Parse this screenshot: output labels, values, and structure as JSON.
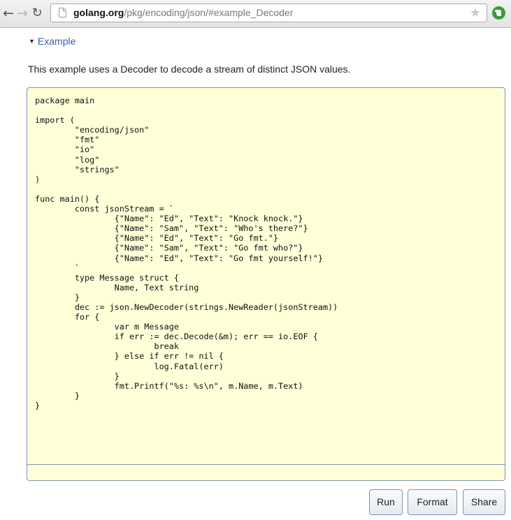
{
  "browser": {
    "back_glyph": "←",
    "forward_glyph": "→",
    "reload_glyph": "↻",
    "url_host": "golang.org",
    "url_path": "/pkg/encoding/json/#example_Decoder",
    "star_glyph": "★",
    "extension_icon": "evernote-icon",
    "extension_color": "#3c9b3c"
  },
  "example": {
    "toggle_caret": "▼",
    "toggle_label": "Example",
    "description": "This example uses a Decoder to decode a stream of distinct JSON values.",
    "code": "package main\n\nimport (\n\t\"encoding/json\"\n\t\"fmt\"\n\t\"io\"\n\t\"log\"\n\t\"strings\"\n)\n\nfunc main() {\n\tconst jsonStream = `\n\t\t{\"Name\": \"Ed\", \"Text\": \"Knock knock.\"}\n\t\t{\"Name\": \"Sam\", \"Text\": \"Who's there?\"}\n\t\t{\"Name\": \"Ed\", \"Text\": \"Go fmt.\"}\n\t\t{\"Name\": \"Sam\", \"Text\": \"Go fmt who?\"}\n\t\t{\"Name\": \"Ed\", \"Text\": \"Go fmt yourself!\"}\n\t`\n\ttype Message struct {\n\t\tName, Text string\n\t}\n\tdec := json.NewDecoder(strings.NewReader(jsonStream))\n\tfor {\n\t\tvar m Message\n\t\tif err := dec.Decode(&m); err == io.EOF {\n\t\t\tbreak\n\t\t} else if err != nil {\n\t\t\tlog.Fatal(err)\n\t\t}\n\t\tfmt.Printf(\"%s: %s\\n\", m.Name, m.Text)\n\t}\n}",
    "buttons": {
      "run": "Run",
      "format": "Format",
      "share": "Share"
    }
  },
  "colors": {
    "link": "#375eab",
    "code_background": "#ffffd8",
    "code_border": "#7c94b0"
  }
}
